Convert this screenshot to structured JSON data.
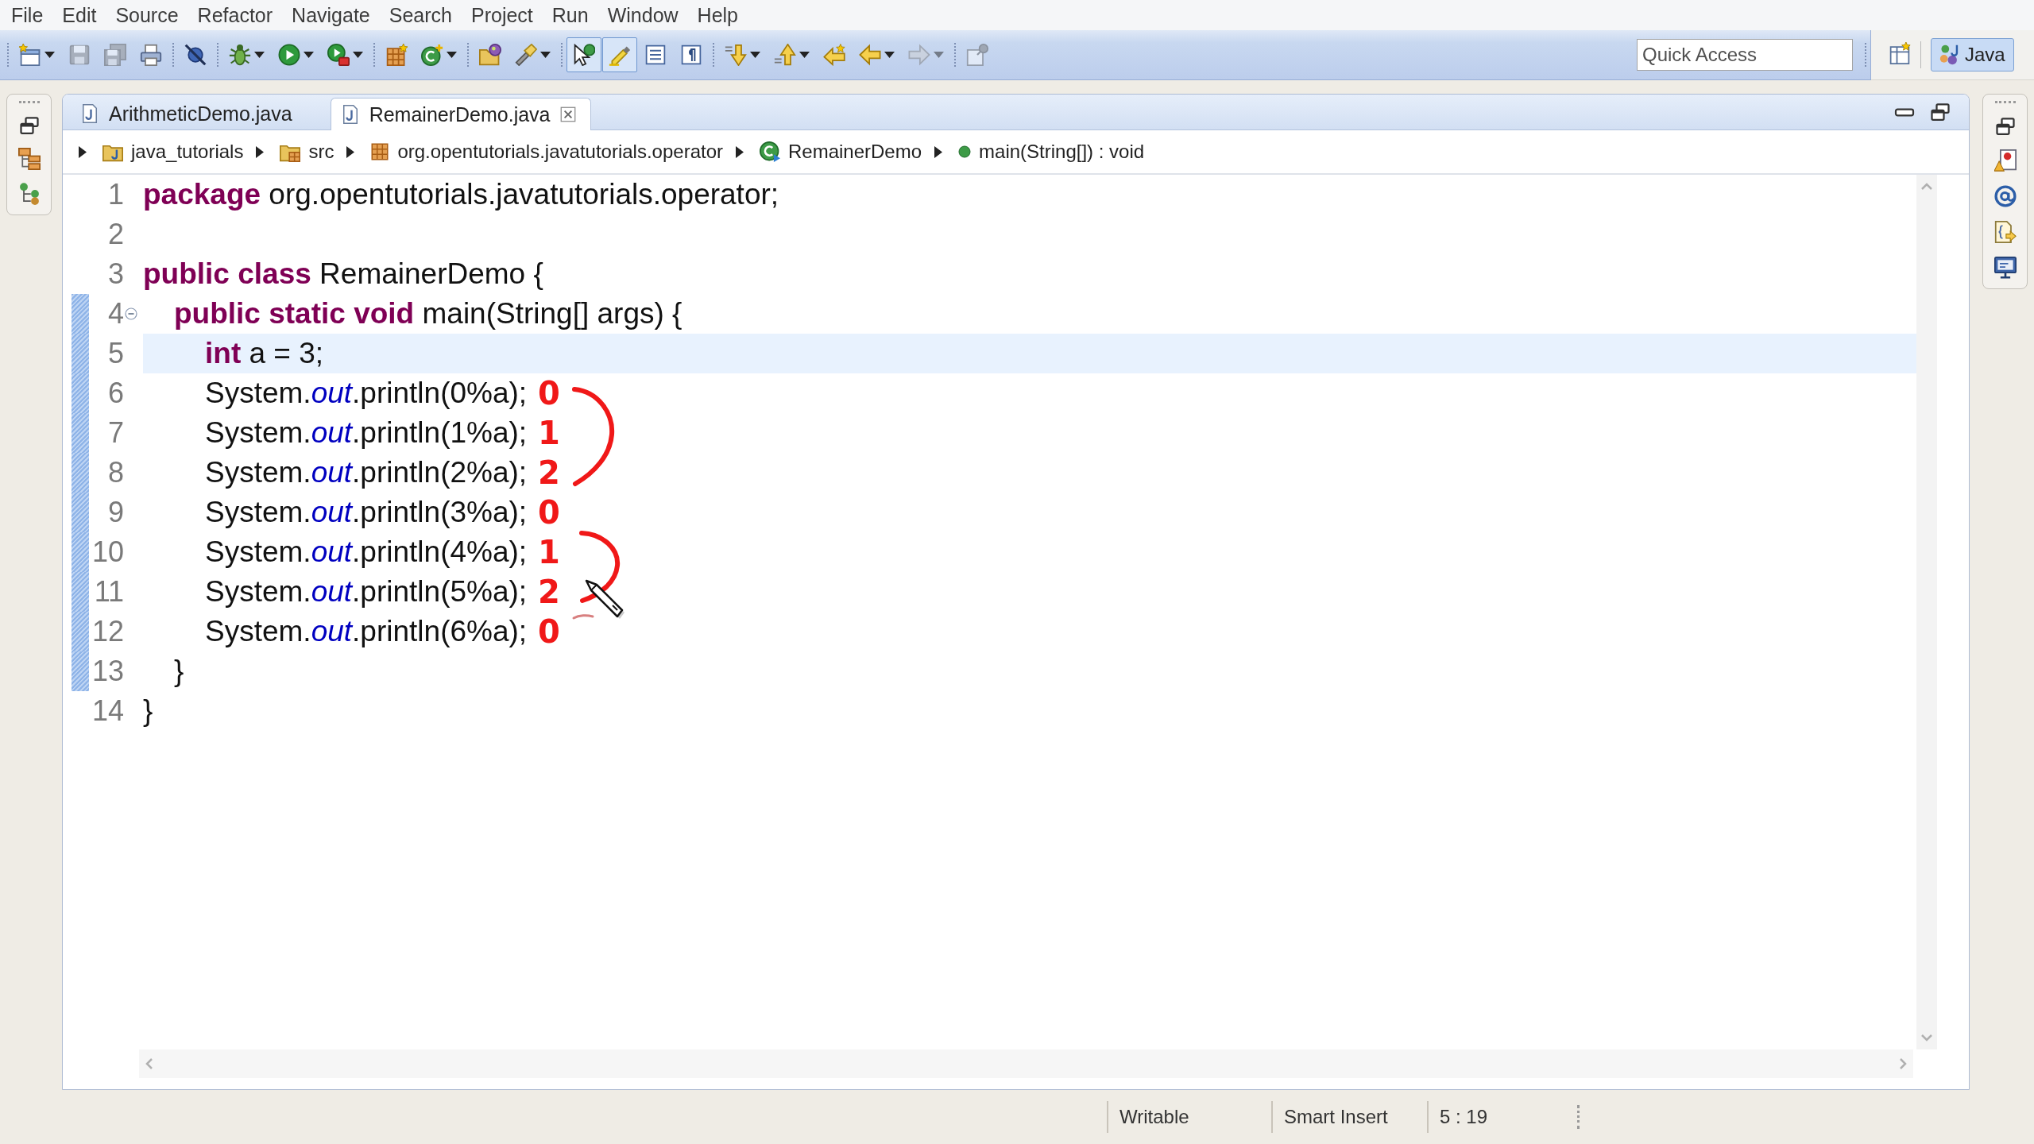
{
  "menu": [
    "File",
    "Edit",
    "Source",
    "Refactor",
    "Navigate",
    "Search",
    "Project",
    "Run",
    "Window",
    "Help"
  ],
  "toolbar": {
    "groups": [
      [
        {
          "dropdown": true,
          "disabled": false,
          "pressed": false
        },
        {
          "dropdown": false,
          "disabled": true,
          "pressed": false
        },
        {
          "dropdown": false,
          "disabled": true,
          "pressed": false
        },
        {
          "dropdown": false,
          "disabled": false,
          "pressed": false
        }
      ],
      [
        {
          "dropdown": false,
          "disabled": false,
          "pressed": false
        }
      ],
      [
        {
          "dropdown": true,
          "disabled": false,
          "pressed": false
        },
        {
          "dropdown": true,
          "disabled": false,
          "pressed": false
        },
        {
          "dropdown": true,
          "disabled": false,
          "pressed": false
        }
      ],
      [
        {
          "dropdown": false,
          "disabled": false,
          "pressed": false
        },
        {
          "dropdown": true,
          "disabled": false,
          "pressed": false
        }
      ],
      [
        {
          "dropdown": false,
          "disabled": false,
          "pressed": false
        },
        {
          "dropdown": true,
          "disabled": false,
          "pressed": false
        }
      ],
      [
        {
          "dropdown": false,
          "disabled": false,
          "pressed": true
        },
        {
          "dropdown": false,
          "disabled": false,
          "pressed": true
        },
        {
          "dropdown": false,
          "disabled": false,
          "pressed": false
        },
        {
          "dropdown": false,
          "disabled": false,
          "pressed": false
        }
      ],
      [
        {
          "dropdown": true,
          "disabled": false,
          "pressed": false
        },
        {
          "dropdown": true,
          "disabled": false,
          "pressed": false
        },
        {
          "dropdown": false,
          "disabled": false,
          "pressed": false
        },
        {
          "dropdown": true,
          "disabled": false,
          "pressed": false
        },
        {
          "dropdown": true,
          "disabled": true,
          "pressed": false
        }
      ],
      [
        {
          "dropdown": false,
          "disabled": true,
          "pressed": false
        }
      ]
    ],
    "quick_access": {
      "placeholder": "Quick Access"
    },
    "perspectives": [
      {
        "label": "Java",
        "selected": true
      }
    ]
  },
  "editor": {
    "tabs": [
      {
        "label": "ArithmeticDemo.java",
        "selected": false
      },
      {
        "label": "RemainerDemo.java",
        "selected": true
      }
    ],
    "breadcrumb": [
      {
        "kind": "project",
        "label": "java_tutorials"
      },
      {
        "kind": "source_folder",
        "label": "src"
      },
      {
        "kind": "package",
        "label": "org.opentutorials.javatutorials.operator"
      },
      {
        "kind": "class",
        "label": "RemainerDemo"
      },
      {
        "kind": "method",
        "label": "main(String[]) : void"
      }
    ],
    "lines": [
      {
        "number": "1",
        "text": "**package** org.opentutorials.javatutorials.operator;",
        "current": false,
        "changed": false
      },
      {
        "number": "2",
        "current": false,
        "changed": false
      },
      {
        "number": "3",
        "text": "**public class** RemainerDemo {",
        "current": false,
        "changed": false,
        "children": [
          {
            "number": "4",
            "text": "**public static void** main(String[] args) {",
            "current": false,
            "changed": true,
            "expanded": true,
            "children": [
              {
                "number": "5",
                "text": "**int** a = 3;",
                "current": true,
                "changed": true
              },
              {
                "number": "6",
                "text": "System.*out*.println(0%a);",
                "current": false,
                "changed": true,
                "note": "0"
              },
              {
                "number": "7",
                "text": "System.*out*.println(1%a);",
                "current": false,
                "changed": true,
                "note": "1"
              },
              {
                "number": "8",
                "text": "System.*out*.println(2%a);",
                "current": false,
                "changed": true,
                "note": "2"
              },
              {
                "number": "9",
                "text": "System.*out*.println(3%a);",
                "current": false,
                "changed": true,
                "note": "0"
              },
              {
                "number": "10",
                "text": "System.*out*.println(4%a);",
                "current": false,
                "changed": true,
                "note": "1"
              },
              {
                "number": "11",
                "text": "System.*out*.println(5%a);",
                "current": false,
                "changed": true,
                "note": "2"
              },
              {
                "number": "12",
                "text": "System.*out*.println(6%a);",
                "current": false,
                "changed": true,
                "note": "0"
              }
            ]
          },
          {
            "number": "13",
            "text": "}",
            "current": false,
            "changed": true
          }
        ]
      },
      {
        "number": "14",
        "text": "}",
        "current": false,
        "changed": false
      }
    ]
  },
  "status_bar": [
    "Writable",
    "Smart Insert",
    "5 : 19"
  ]
}
